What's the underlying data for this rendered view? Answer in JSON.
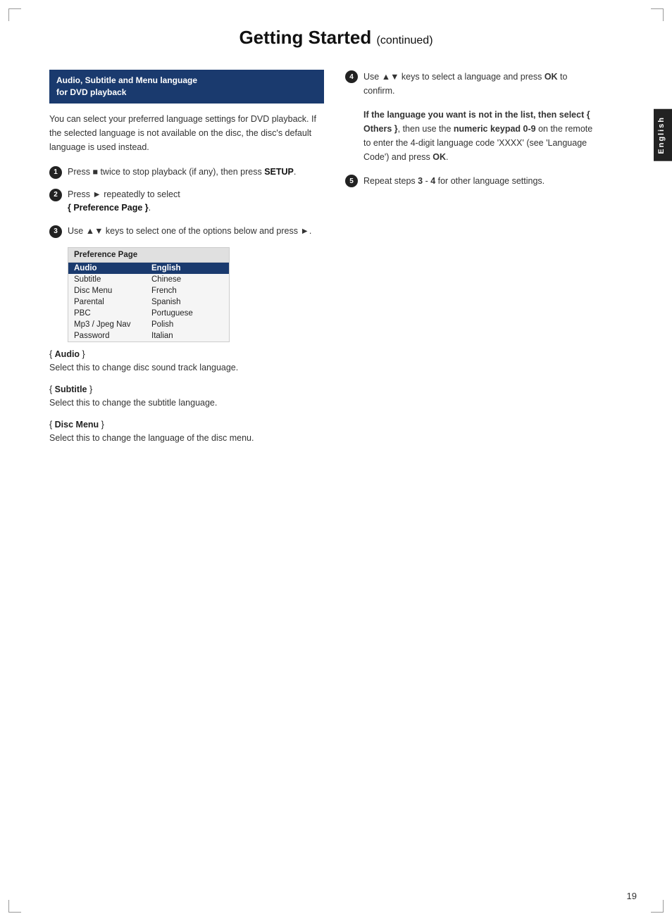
{
  "page": {
    "title": "Getting Started",
    "title_suffix": "(continued)",
    "page_number": "19",
    "side_tab_label": "English"
  },
  "section": {
    "header_line1": "Audio, Subtitle and Menu language",
    "header_line2": "for DVD playback",
    "intro": "You can select your preferred language settings for DVD playback. If the selected language is not available on the disc, the disc's default language is used instead."
  },
  "steps_left": [
    {
      "number": "1",
      "text": "Press ■ twice to stop playback (if any), then press ",
      "bold": "SETUP",
      "after": "."
    },
    {
      "number": "2",
      "text": "Press ► repeatedly to select",
      "bold": "{ Preference Page }",
      "after": ".",
      "prefix": ""
    },
    {
      "number": "3",
      "text": "Use ▲▼ keys to select one of the options below and press ►."
    }
  ],
  "preference_table": {
    "header": "Preference Page",
    "rows": [
      {
        "left": "Audio",
        "right": "English",
        "highlighted": true
      },
      {
        "left": "Subtitle",
        "right": "Chinese",
        "highlighted": false
      },
      {
        "left": "Disc Menu",
        "right": "French",
        "highlighted": false
      },
      {
        "left": "Parental",
        "right": "Spanish",
        "highlighted": false
      },
      {
        "left": "PBC",
        "right": "Portuguese",
        "highlighted": false
      },
      {
        "left": "Mp3 / Jpeg Nav",
        "right": "Polish",
        "highlighted": false
      },
      {
        "left": "Password",
        "right": "Italian",
        "highlighted": false
      }
    ]
  },
  "section_items": [
    {
      "title_prefix": "{ ",
      "title_bold": "Audio",
      "title_suffix": " }",
      "desc": "Select this to change disc sound track language."
    },
    {
      "title_prefix": "{ ",
      "title_bold": "Subtitle",
      "title_suffix": " }",
      "desc": "Select this to change the subtitle language."
    },
    {
      "title_prefix": "{ ",
      "title_bold": "Disc Menu",
      "title_suffix": " }",
      "desc": "Select this to change the language of the disc menu."
    }
  ],
  "steps_right": [
    {
      "number": "4",
      "text": "Use ▲▼ keys to select a language and press ",
      "bold": "OK",
      "after": " to confirm."
    }
  ],
  "right_bold_block": "If the language you want is not in the list, then select { Others }, then use the numeric keypad 0-9 on the remote to enter the 4-digit language code 'XXXX' (see 'Language Code') and press OK.",
  "step5": {
    "number": "5",
    "text": "Repeat steps ",
    "bold3": "3",
    "dash": " - ",
    "bold4": "4",
    "after": " for other language settings."
  }
}
